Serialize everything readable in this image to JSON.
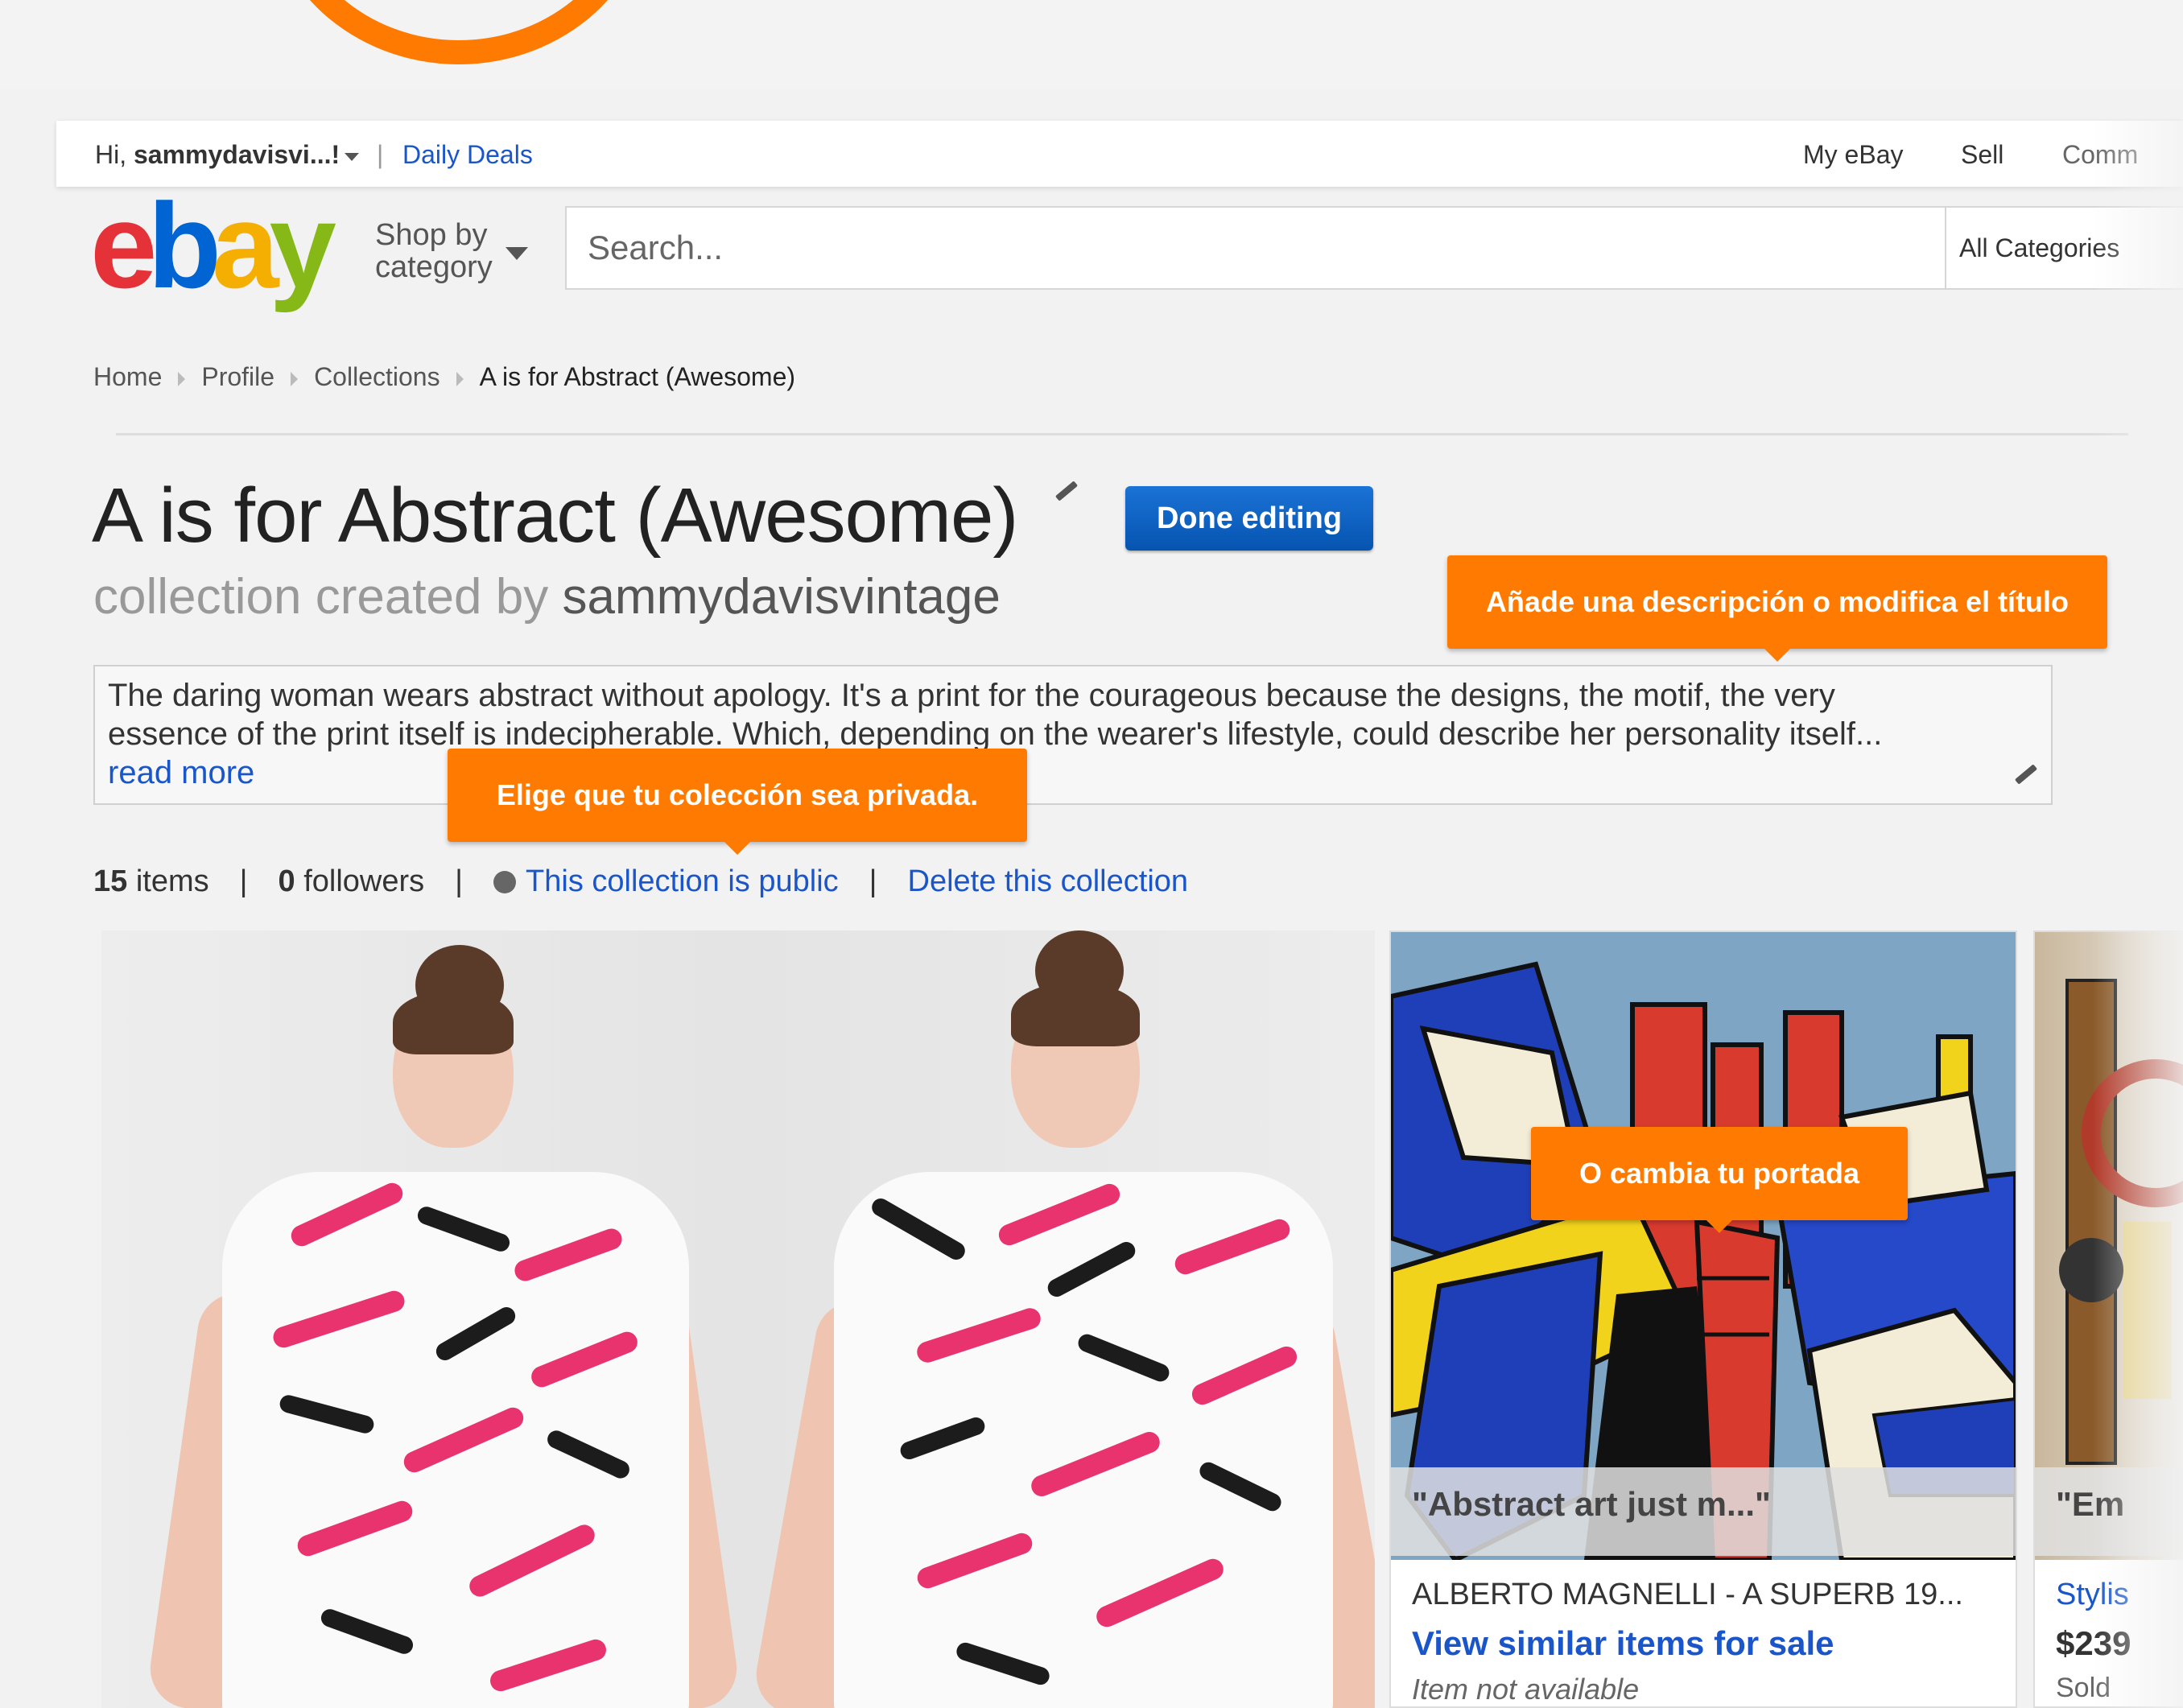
{
  "userbar": {
    "greeting_prefix": "Hi, ",
    "username": "sammydavisvi...!",
    "daily_deals": "Daily Deals",
    "my_ebay": "My eBay",
    "sell": "Sell",
    "community": "Comm"
  },
  "header": {
    "logo": {
      "e": "e",
      "b": "b",
      "a": "a",
      "y": "y"
    },
    "shop_by_line1": "Shop by",
    "shop_by_line2": "category",
    "search_placeholder": "Search...",
    "categories": "All Categories"
  },
  "breadcrumb": [
    "Home",
    "Profile",
    "Collections",
    "A is for Abstract (Awesome)"
  ],
  "collection": {
    "title": "A is for Abstract (Awesome)",
    "done_button": "Done editing",
    "created_by_prefix": "collection created by ",
    "creator": "sammydavisvintage",
    "description_line1": "The daring woman wears abstract without apology. It's a print for the courageous because the designs, the motif, the very",
    "description_line2": "essence of the print itself is indecipherable. Which, depending on the wearer's lifestyle, could describe her personality itself...",
    "read_more": "read more",
    "items_count": "15",
    "items_label": " items",
    "followers_count": "0",
    "followers_label": " followers",
    "public_link": "This collection is public",
    "delete_link": "Delete this collection"
  },
  "tooltips": {
    "description": "Añade una descripción o modifica el título",
    "privacy": "Elige que tu colección sea privada.",
    "cover": "O cambia tu portada"
  },
  "card": {
    "caption": "\"Abstract art just m...\"",
    "title": "ALBERTO MAGNELLI - A SUPERB 19...",
    "link": "View similar items for sale",
    "status": "Item not available"
  },
  "peek_card": {
    "caption": "\"Em",
    "line1": "Stylis",
    "line2": "$239",
    "line3": "Sold"
  },
  "colors": {
    "accent_orange": "#ff7a00",
    "link_blue": "#1a56c9",
    "button_blue": "#0654b0"
  }
}
